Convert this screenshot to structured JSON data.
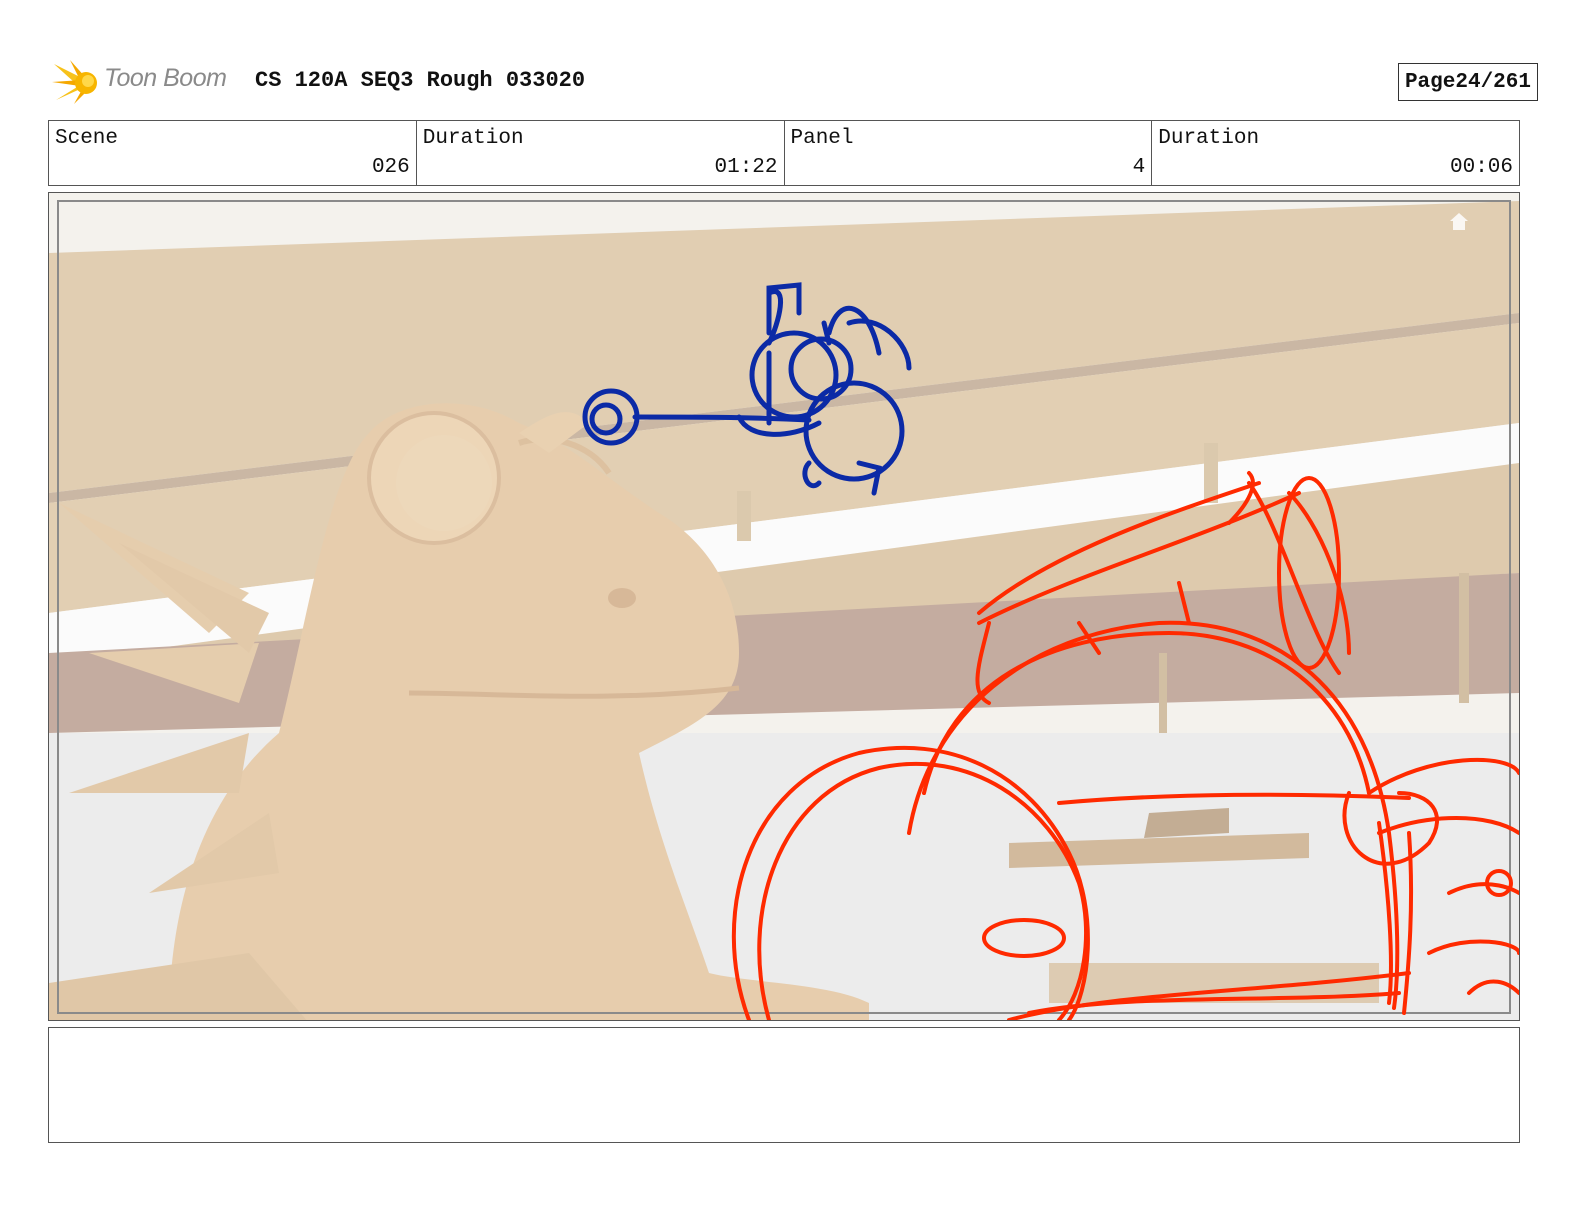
{
  "header": {
    "logo_text": "Toon Boom",
    "logo_icon": "toon-boom-burst-icon",
    "title": "CS 120A SEQ3 Rough 033020",
    "page_label": "Page",
    "page_value": "24/261"
  },
  "info": {
    "scene_label": "Scene",
    "scene_value": "026",
    "scene_duration_label": "Duration",
    "scene_duration_value": "01:22",
    "panel_label": "Panel",
    "panel_value": "4",
    "panel_duration_label": "Duration",
    "panel_duration_value": "00:06"
  },
  "panel": {
    "home_icon": "home-icon",
    "accent_colors": {
      "blue_sketch": "#0b2aa6",
      "red_sketch": "#ff2a00",
      "background_tan": "#d9c2a0",
      "frog_tan": "#e3c59e"
    }
  },
  "notes": {
    "text": ""
  }
}
